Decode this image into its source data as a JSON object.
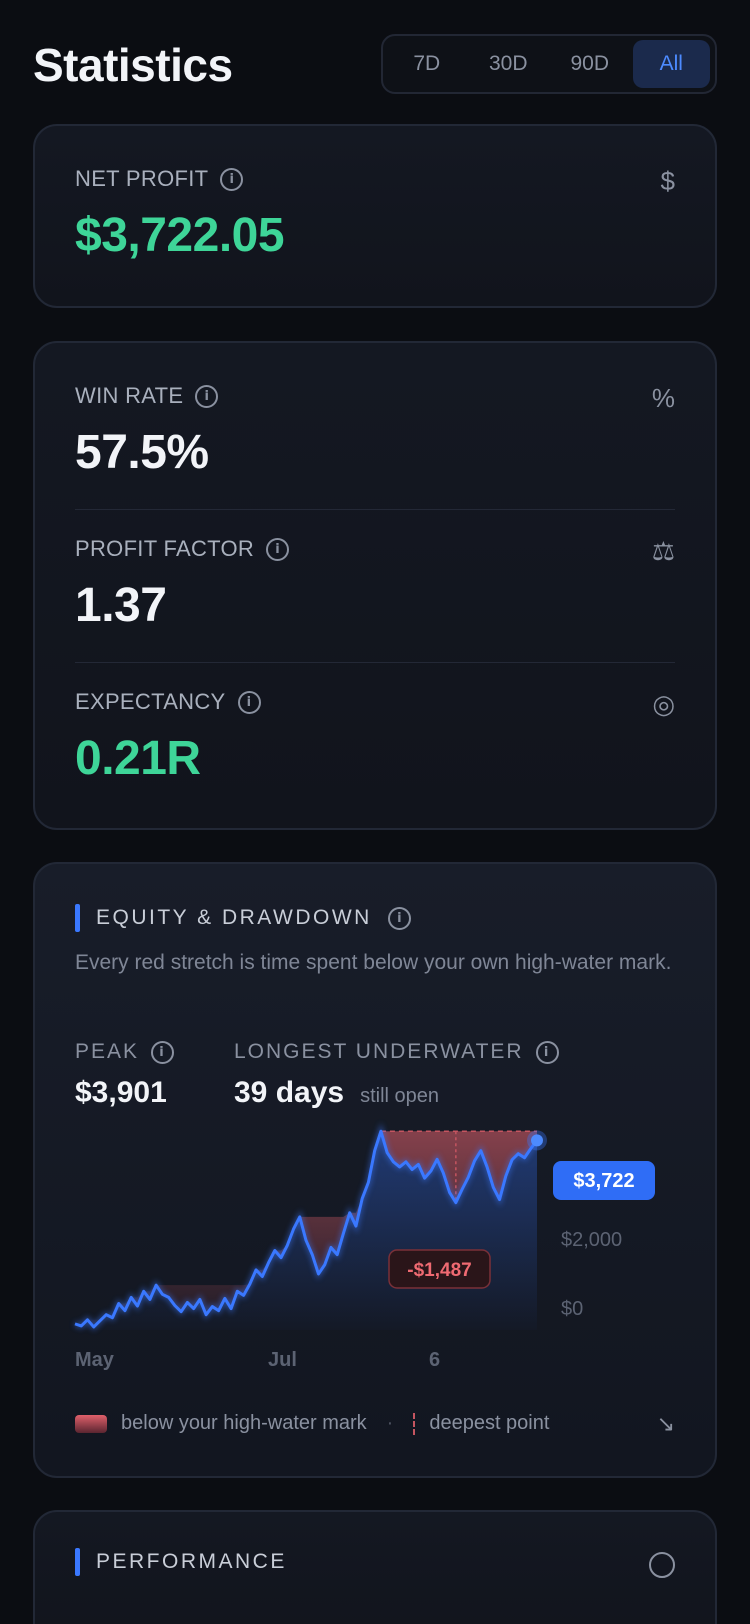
{
  "header": {
    "title": "Statistics",
    "ranges": [
      "7D",
      "30D",
      "90D",
      "All"
    ],
    "active_range": "All"
  },
  "net_profit": {
    "label": "NET PROFIT",
    "value": "$3,722.05",
    "icon": "dollar-icon"
  },
  "win_rate": {
    "label": "WIN RATE",
    "value": "57.5%",
    "icon": "percent-icon"
  },
  "profit_factor": {
    "label": "PROFIT FACTOR",
    "value": "1.37",
    "icon": "scale-icon"
  },
  "expectancy": {
    "label": "EXPECTANCY",
    "value": "0.21R",
    "icon": "target-icon"
  },
  "equity": {
    "title": "EQUITY & DRAWDOWN",
    "subtitle": "Every red stretch is time spent below your own high-water mark.",
    "peak_label": "PEAK",
    "peak_value": "$3,901",
    "underwater_label": "LONGEST UNDERWATER",
    "underwater_value": "39 days",
    "underwater_note": "still open",
    "current_badge": "$3,722",
    "drawdown_badge": "-$1,487",
    "legend_below": "below your high-water mark",
    "legend_deepest": "deepest point"
  },
  "performance": {
    "title": "PERFORMANCE"
  },
  "colors": {
    "green": "#3ed598",
    "accent": "#3a78ff",
    "red": "#e0606b"
  },
  "chart_data": {
    "type": "area",
    "x_ticks": [
      "May",
      "Jul",
      "6"
    ],
    "y_ticks": [
      "$0",
      "$2,000"
    ],
    "ylim": [
      0,
      4200
    ],
    "series": [
      {
        "values": [
          120,
          80,
          200,
          60,
          180,
          300,
          240,
          520,
          380,
          640,
          470,
          760,
          600,
          880,
          700,
          640,
          480,
          360,
          540,
          420,
          600,
          300,
          460,
          380,
          620,
          420,
          760,
          680,
          900,
          1180,
          1050,
          1320,
          1560,
          1420,
          1660,
          1980,
          2220,
          1760,
          1480,
          1100,
          1280,
          1620,
          1480,
          1900,
          2300,
          2040,
          2580,
          2900,
          3520,
          3901,
          3480,
          3300,
          3200,
          3300,
          3150,
          3250,
          2980,
          3120,
          3350,
          3080,
          2700,
          2500,
          2760,
          3000,
          3320,
          3520,
          3200,
          2800,
          2560,
          3020,
          3340,
          3460,
          3380,
          3560,
          3722
        ],
        "high_water": [
          120,
          120,
          200,
          200,
          200,
          300,
          300,
          520,
          520,
          640,
          640,
          760,
          760,
          880,
          880,
          880,
          880,
          880,
          880,
          880,
          880,
          880,
          880,
          880,
          880,
          880,
          880,
          880,
          900,
          1180,
          1180,
          1320,
          1560,
          1560,
          1660,
          1980,
          2220,
          2220,
          2220,
          2220,
          2220,
          2220,
          2220,
          2220,
          2300,
          2300,
          2580,
          2900,
          3520,
          3901,
          3901,
          3901,
          3901,
          3901,
          3901,
          3901,
          3901,
          3901,
          3901,
          3901,
          3901,
          3901,
          3901,
          3901,
          3901,
          3901,
          3901,
          3901,
          3901,
          3901,
          3901,
          3901,
          3901,
          3901,
          3901
        ]
      }
    ],
    "peak": 3901,
    "current": 3722,
    "max_drawdown": -1487
  }
}
